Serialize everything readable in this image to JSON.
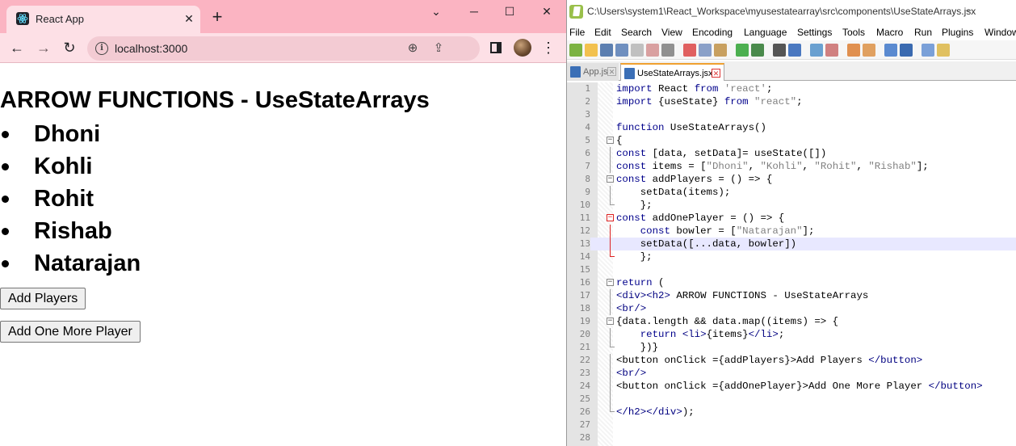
{
  "browser": {
    "tab_title": "React App",
    "tab_close": "✕",
    "new_tab": "+",
    "window": {
      "minimize": "─",
      "maximize": "☐",
      "close": "✕",
      "collapse": "⌄"
    },
    "url": "localhost:3000",
    "info_glyph": "i",
    "nav": {
      "back": "←",
      "forward": "→",
      "reload": "↻",
      "menu": "⋮"
    },
    "omnibox_icons": {
      "zoom": "⊕",
      "share": "⇪",
      "bookmark": "★"
    },
    "icon_names": [
      "react-favicon-icon",
      "zoom-icon",
      "share-icon",
      "bookmark-star-icon",
      "side-panel-icon",
      "profile-avatar-icon"
    ],
    "accent_color": "#1a73e8",
    "tab_strip_color": "#fbb4c2"
  },
  "page": {
    "heading": "ARROW FUNCTIONS - UseStateArrays",
    "players": [
      "Dhoni",
      "Kohli",
      "Rohit",
      "Rishab",
      "Natarajan"
    ],
    "add_players_button": "Add Players",
    "add_one_button": "Add One More Player"
  },
  "editor": {
    "title_path": "C:\\Users\\system1\\React_Workspace\\myusestatearray\\src\\components\\UseStateArrays.jsx",
    "title_suffix": "–",
    "menu": [
      "File",
      "Edit",
      "Search",
      "View",
      "Encoding",
      "Language",
      "Settings",
      "Tools",
      "Macro",
      "Run",
      "Plugins",
      "Window"
    ],
    "tabs": [
      {
        "label": "App.js",
        "active": false
      },
      {
        "label": "UseStateArrays.jsx",
        "active": true
      }
    ],
    "tab_close": "✕",
    "fold_glyph": "−",
    "highlighted_line": 13,
    "lines": [
      {
        "n": "1",
        "text": "import React from 'react';"
      },
      {
        "n": "2",
        "text": "import {useState} from \"react\";"
      },
      {
        "n": "3",
        "text": ""
      },
      {
        "n": "4",
        "text": "function UseStateArrays()"
      },
      {
        "n": "5",
        "text": "{"
      },
      {
        "n": "6",
        "text": "const [data, setData]= useState([])"
      },
      {
        "n": "7",
        "text": "const items = [\"Dhoni\", \"Kohli\", \"Rohit\", \"Rishab\"];"
      },
      {
        "n": "8",
        "text": "const addPlayers = () => {"
      },
      {
        "n": "9",
        "text": "    setData(items);"
      },
      {
        "n": "10",
        "text": "    };"
      },
      {
        "n": "11",
        "text": "const addOnePlayer = () => {"
      },
      {
        "n": "12",
        "text": "    const bowler = [\"Natarajan\"];"
      },
      {
        "n": "13",
        "text": "    setData([...data, bowler])"
      },
      {
        "n": "14",
        "text": "    };"
      },
      {
        "n": "15",
        "text": ""
      },
      {
        "n": "16",
        "text": "return ("
      },
      {
        "n": "17",
        "text": "<div><h2> ARROW FUNCTIONS - UseStateArrays"
      },
      {
        "n": "18",
        "text": "<br/>"
      },
      {
        "n": "19",
        "text": "{data.length && data.map((items) => {"
      },
      {
        "n": "20",
        "text": "    return <li>{items}</li>;"
      },
      {
        "n": "21",
        "text": "    })}"
      },
      {
        "n": "22",
        "text": "<button onClick ={addPlayers}>Add Players </button>"
      },
      {
        "n": "23",
        "text": "<br/>"
      },
      {
        "n": "24",
        "text": "<button onClick ={addOnePlayer}>Add One More Player </button>"
      },
      {
        "n": "25",
        "text": ""
      },
      {
        "n": "26",
        "text": "</h2></div>);"
      },
      {
        "n": "27",
        "text": ""
      },
      {
        "n": "28",
        "text": ""
      }
    ]
  }
}
